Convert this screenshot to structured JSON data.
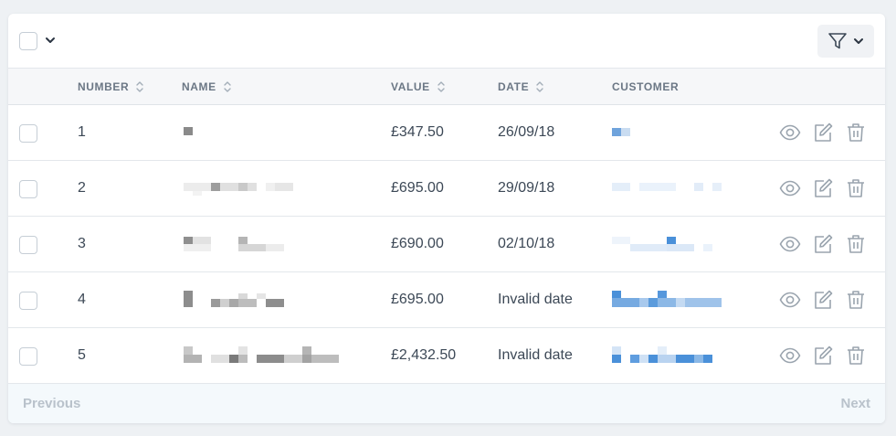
{
  "toolbar": {
    "select_icon": "chevron-down-icon",
    "filter_icon": "filter-icon"
  },
  "columns": [
    {
      "key": "number",
      "label": "NUMBER",
      "sortable": true
    },
    {
      "key": "name",
      "label": "NAME",
      "sortable": true
    },
    {
      "key": "value",
      "label": "VALUE",
      "sortable": true
    },
    {
      "key": "date",
      "label": "DATE",
      "sortable": true
    },
    {
      "key": "customer",
      "label": "CUSTOMER",
      "sortable": false
    }
  ],
  "rows": [
    {
      "number": "1",
      "name": "",
      "value": "£347.50",
      "date": "26/09/18",
      "customer": ""
    },
    {
      "number": "2",
      "name": "",
      "value": "£695.00",
      "date": "29/09/18",
      "customer": ""
    },
    {
      "number": "3",
      "name": "",
      "value": "£690.00",
      "date": "02/10/18",
      "customer": ""
    },
    {
      "number": "4",
      "name": "",
      "value": "£695.00",
      "date": "Invalid date",
      "customer": ""
    },
    {
      "number": "5",
      "name": "",
      "value": "£2,432.50",
      "date": "Invalid date",
      "customer": ""
    }
  ],
  "row_actions": [
    "eye-icon",
    "edit-icon",
    "trash-icon"
  ],
  "pagination": {
    "previous": "Previous",
    "next": "Next"
  },
  "colors": {
    "background": "#eef1f4",
    "header_bg": "#f6f7f9",
    "footer_bg": "#f4f9fc",
    "text": "#3c4856",
    "muted": "#6b7785",
    "icon": "#9aa4ae",
    "name_blur": "#9b9b9b",
    "customer_blur": "#4a90d9"
  }
}
